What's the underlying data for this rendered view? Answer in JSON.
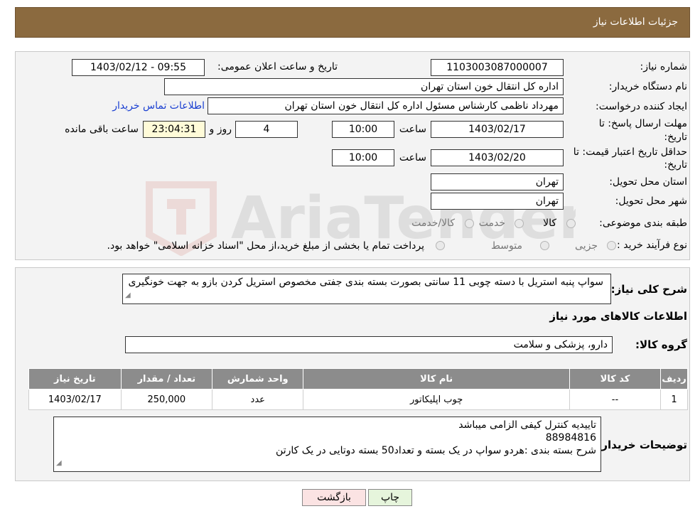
{
  "header": {
    "title": "جزئیات اطلاعات نیاز"
  },
  "fields": {
    "need_number_label": "شماره نیاز:",
    "need_number": "1103003087000007",
    "announce_label": "تاریخ و ساعت اعلان عمومی:",
    "announce_value": "1403/02/12 - 09:55",
    "buyer_label": "نام دستگاه خریدار:",
    "buyer_value": "اداره کل انتقال خون استان تهران",
    "creator_label": "ایجاد کننده درخواست:",
    "creator_value": "مهرداد ناظمی کارشناس مسئول اداره کل انتقال خون استان تهران",
    "contact_link": "اطلاعات تماس خریدار",
    "deadline_label_1": "مهلت ارسال پاسخ: تا",
    "deadline_label_2": "تاریخ:",
    "deadline_date": "1403/02/17",
    "hour_label": "ساعت",
    "deadline_time": "10:00",
    "days_value": "4",
    "days_label": "روز و",
    "remaining_value": "23:04:31",
    "remaining_label": "ساعت باقی مانده",
    "validity_label_1": "حداقل تاریخ اعتبار قیمت: تا",
    "validity_label_2": "تاریخ:",
    "validity_date": "1403/02/20",
    "validity_time": "10:00",
    "province_label": "استان محل تحویل:",
    "province_value": "تهران",
    "city_label": "شهر محل تحویل:",
    "city_value": "تهران",
    "category_label": "طبقه بندی موضوعی:",
    "category_options": [
      "کالا",
      "خدمت",
      "کالا/خدمت"
    ],
    "process_label": "نوع فرآیند خرید :",
    "process_options": [
      "جزیی",
      "متوسط"
    ],
    "process_note": "پرداخت تمام یا بخشی از مبلغ خرید،از محل \"اسناد خزانه اسلامی\" خواهد بود."
  },
  "details": {
    "summary_label": "شرح کلی نیاز:",
    "summary_text": "سواپ پنبه استریل با دسته چوبی 11 سانتی بصورت بسته بندی جفتی مخصوص استریل کردن بازو به جهت خونگیری",
    "goods_info_title": "اطلاعات کالاهای مورد نیاز",
    "group_label": "گروه کالا:",
    "group_value": "دارو، پزشکی و سلامت",
    "table": {
      "headers": [
        "ردیف",
        "کد کالا",
        "نام کالا",
        "واحد شمارش",
        "تعداد / مقدار",
        "تاریخ نیاز"
      ],
      "rows": [
        [
          "1",
          "--",
          "چوب اپلیکاتور",
          "عدد",
          "250,000",
          "1403/02/17"
        ]
      ]
    },
    "buyer_notes_label": "توضیحات خریدار:",
    "buyer_notes_lines": [
      "تاییدیه کنترل کیفی الزامی میباشد",
      "88984816",
      "شرح بسته بندی :هردو سواپ در یک بسته و تعداد50 بسته دوتایی در یک کارتن"
    ]
  },
  "buttons": {
    "print": "چاپ",
    "back": "بازگشت"
  },
  "watermark": {
    "text": "AriaTender.neT"
  },
  "colors": {
    "header": "#8b6a3f",
    "link": "#1a3fd1",
    "table_header": "#8c8c8c"
  }
}
